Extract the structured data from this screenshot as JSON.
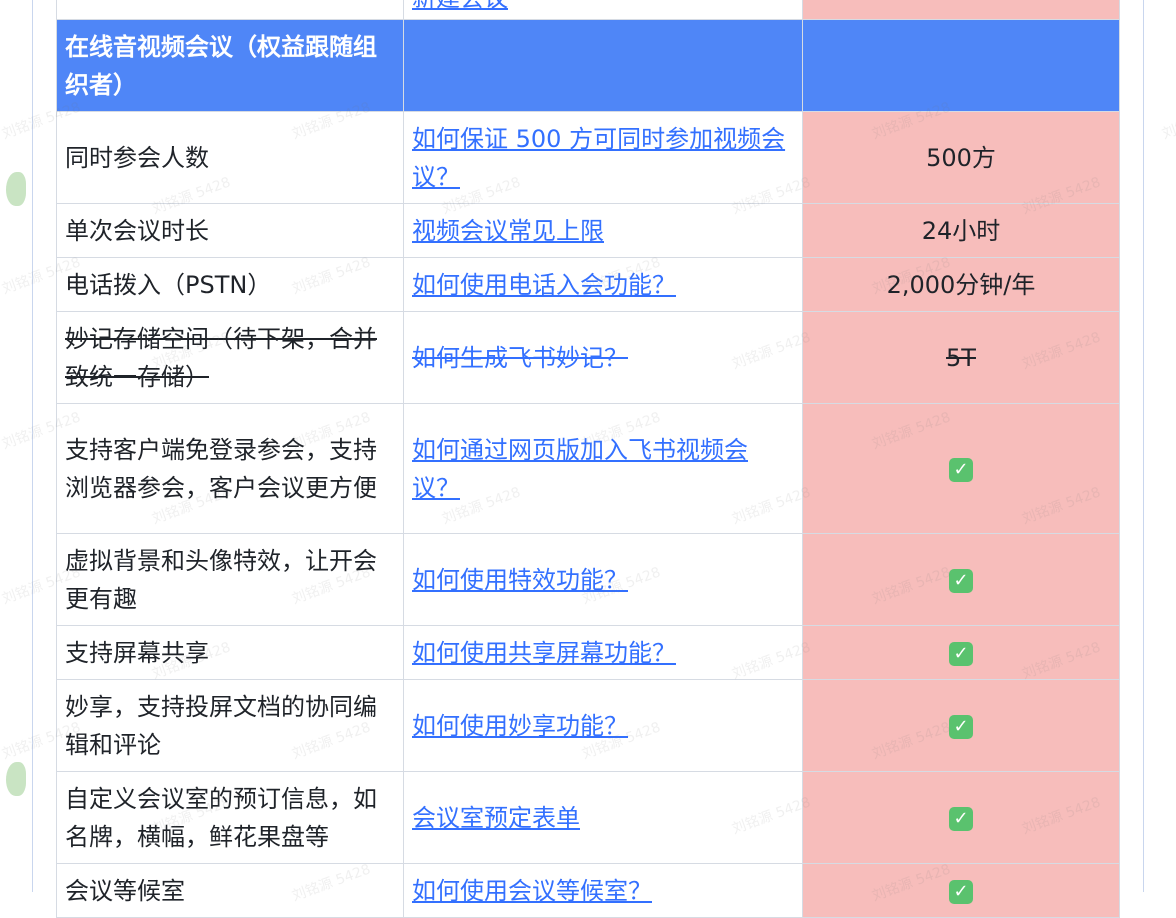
{
  "watermark": "刘铭源 5428",
  "partial_top_row": {
    "link": "新建会议",
    "col3": ""
  },
  "section_header": {
    "label": "在线音视频会议（权益跟随组织者）"
  },
  "rows": [
    {
      "feature": "同时参会人数",
      "link": "如何保证 500 方可同时参加视频会议？",
      "value": "500方",
      "check": false,
      "strike": false
    },
    {
      "feature": "单次会议时长",
      "link": "视频会议常见上限",
      "value": "24小时",
      "check": false,
      "strike": false
    },
    {
      "feature": "电话拨入（PSTN）",
      "link": "如何使用电话入会功能？",
      "value": "2,000分钟/年",
      "check": false,
      "strike": false
    },
    {
      "feature": "妙记存储空间（待下架，合并致统一存储）",
      "link": "如何生成飞书妙记？",
      "value": "5T",
      "check": false,
      "strike": true
    },
    {
      "feature": "支持客户端免登录参会，支持浏览器参会，客户会议更方便",
      "link": "如何通过网页版加入飞书视频会议？",
      "value": "",
      "check": true,
      "strike": false
    },
    {
      "feature": "虚拟背景和头像特效，让开会更有趣",
      "link": "如何使用特效功能？",
      "value": "",
      "check": true,
      "strike": false
    },
    {
      "feature": "支持屏幕共享",
      "link": "如何使用共享屏幕功能？",
      "value": "",
      "check": true,
      "strike": false
    },
    {
      "feature": "妙享，支持投屏文档的协同编辑和评论",
      "link": "如何使用妙享功能？",
      "value": "",
      "check": true,
      "strike": false
    },
    {
      "feature": "自定义会议室的预订信息，如名牌，横幅，鲜花果盘等",
      "link": "会议室预定表单",
      "value": "",
      "check": true,
      "strike": false
    },
    {
      "feature": "会议等候室",
      "link": "如何使用会议等候室？",
      "value": "",
      "check": true,
      "strike": false
    }
  ]
}
